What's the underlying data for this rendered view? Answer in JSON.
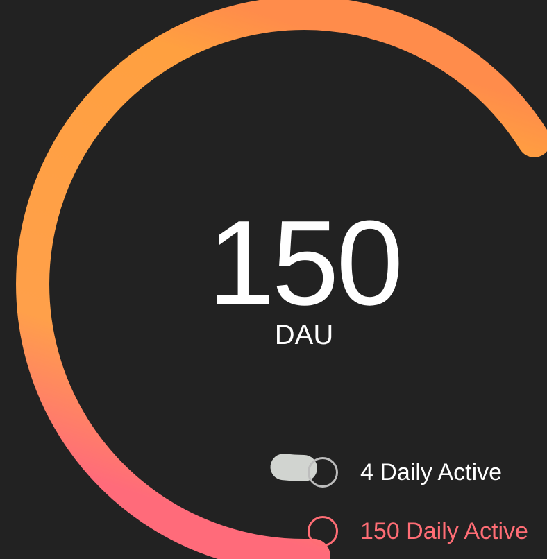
{
  "chart_data": {
    "type": "radial_gauge",
    "center_value": "150",
    "center_label": "DAU",
    "series": [
      {
        "name": "4 Daily Active",
        "value": 4,
        "color": "#d1d4d0",
        "legend_color": "#bdbdbd",
        "text_color": "#ffffff"
      },
      {
        "name": "150 Daily Active",
        "value": 150,
        "color_start": "#ff6b7a",
        "color_mid": "#ffa040",
        "color_end": "#ff8c4b",
        "legend_color": "#ff6d75",
        "text_color": "#ff6d75"
      }
    ]
  }
}
